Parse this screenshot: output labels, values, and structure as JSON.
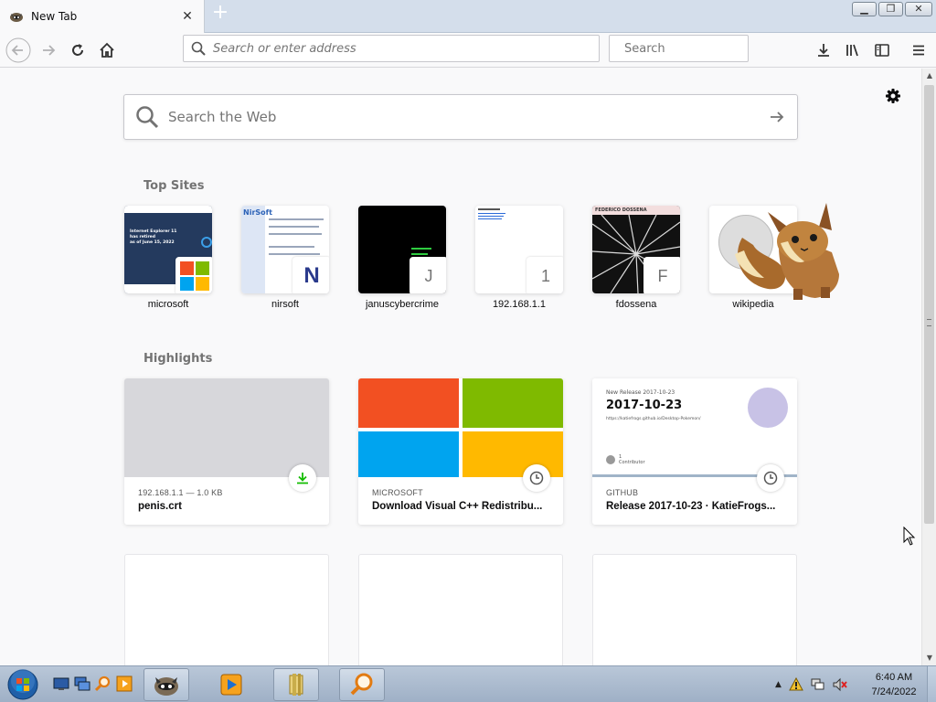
{
  "browser": {
    "tab": {
      "title": "New Tab"
    },
    "url_placeholder": "Search or enter address",
    "search_placeholder": "Search"
  },
  "newtab": {
    "web_search_placeholder": "Search the Web",
    "top_sites_title": "Top Sites",
    "top_sites": [
      {
        "label": "microsoft",
        "badge": ""
      },
      {
        "label": "nirsoft",
        "badge": "N"
      },
      {
        "label": "januscybercrime",
        "badge": "J"
      },
      {
        "label": "192.168.1.1",
        "badge": "1"
      },
      {
        "label": "fdossena",
        "badge": "F"
      },
      {
        "label": "wikipedia",
        "badge": ""
      }
    ],
    "highlights_title": "Highlights",
    "highlights": [
      {
        "source": "192.168.1.1 — 1.0 KB",
        "title": "penis.crt",
        "icon": "download-icon"
      },
      {
        "source": "MICROSOFT",
        "title": "Download Visual C++ Redistribu...",
        "icon": "clock-icon"
      },
      {
        "source": "GITHUB",
        "title": "Release 2017-10-23 · KatieFrogs...",
        "icon": "clock-icon",
        "preview_heading": "New Release 2017-10-23",
        "preview_title": "2017-10-23",
        "preview_link": "https://katiefrogs.github.io/Desktop-Pokemon/",
        "preview_contrib": "1",
        "preview_contrib_label": "Contributor"
      }
    ]
  },
  "thumbs": {
    "microsoft_line1": "Internet Explorer 11 has retired",
    "microsoft_line2": "as of June 15, 2022",
    "nirsoft_logo": "NirSoft",
    "fdossena_header": "FEDERICO DOSSENA"
  },
  "taskbar": {
    "time": "6:40 AM",
    "date": "7/24/2022"
  },
  "colors": {
    "accent": "#0a84ff",
    "download_green": "#12bc00",
    "ms_red": "#f25022",
    "ms_green": "#7fba00",
    "ms_blue": "#00a4ef",
    "ms_yellow": "#ffb900"
  }
}
